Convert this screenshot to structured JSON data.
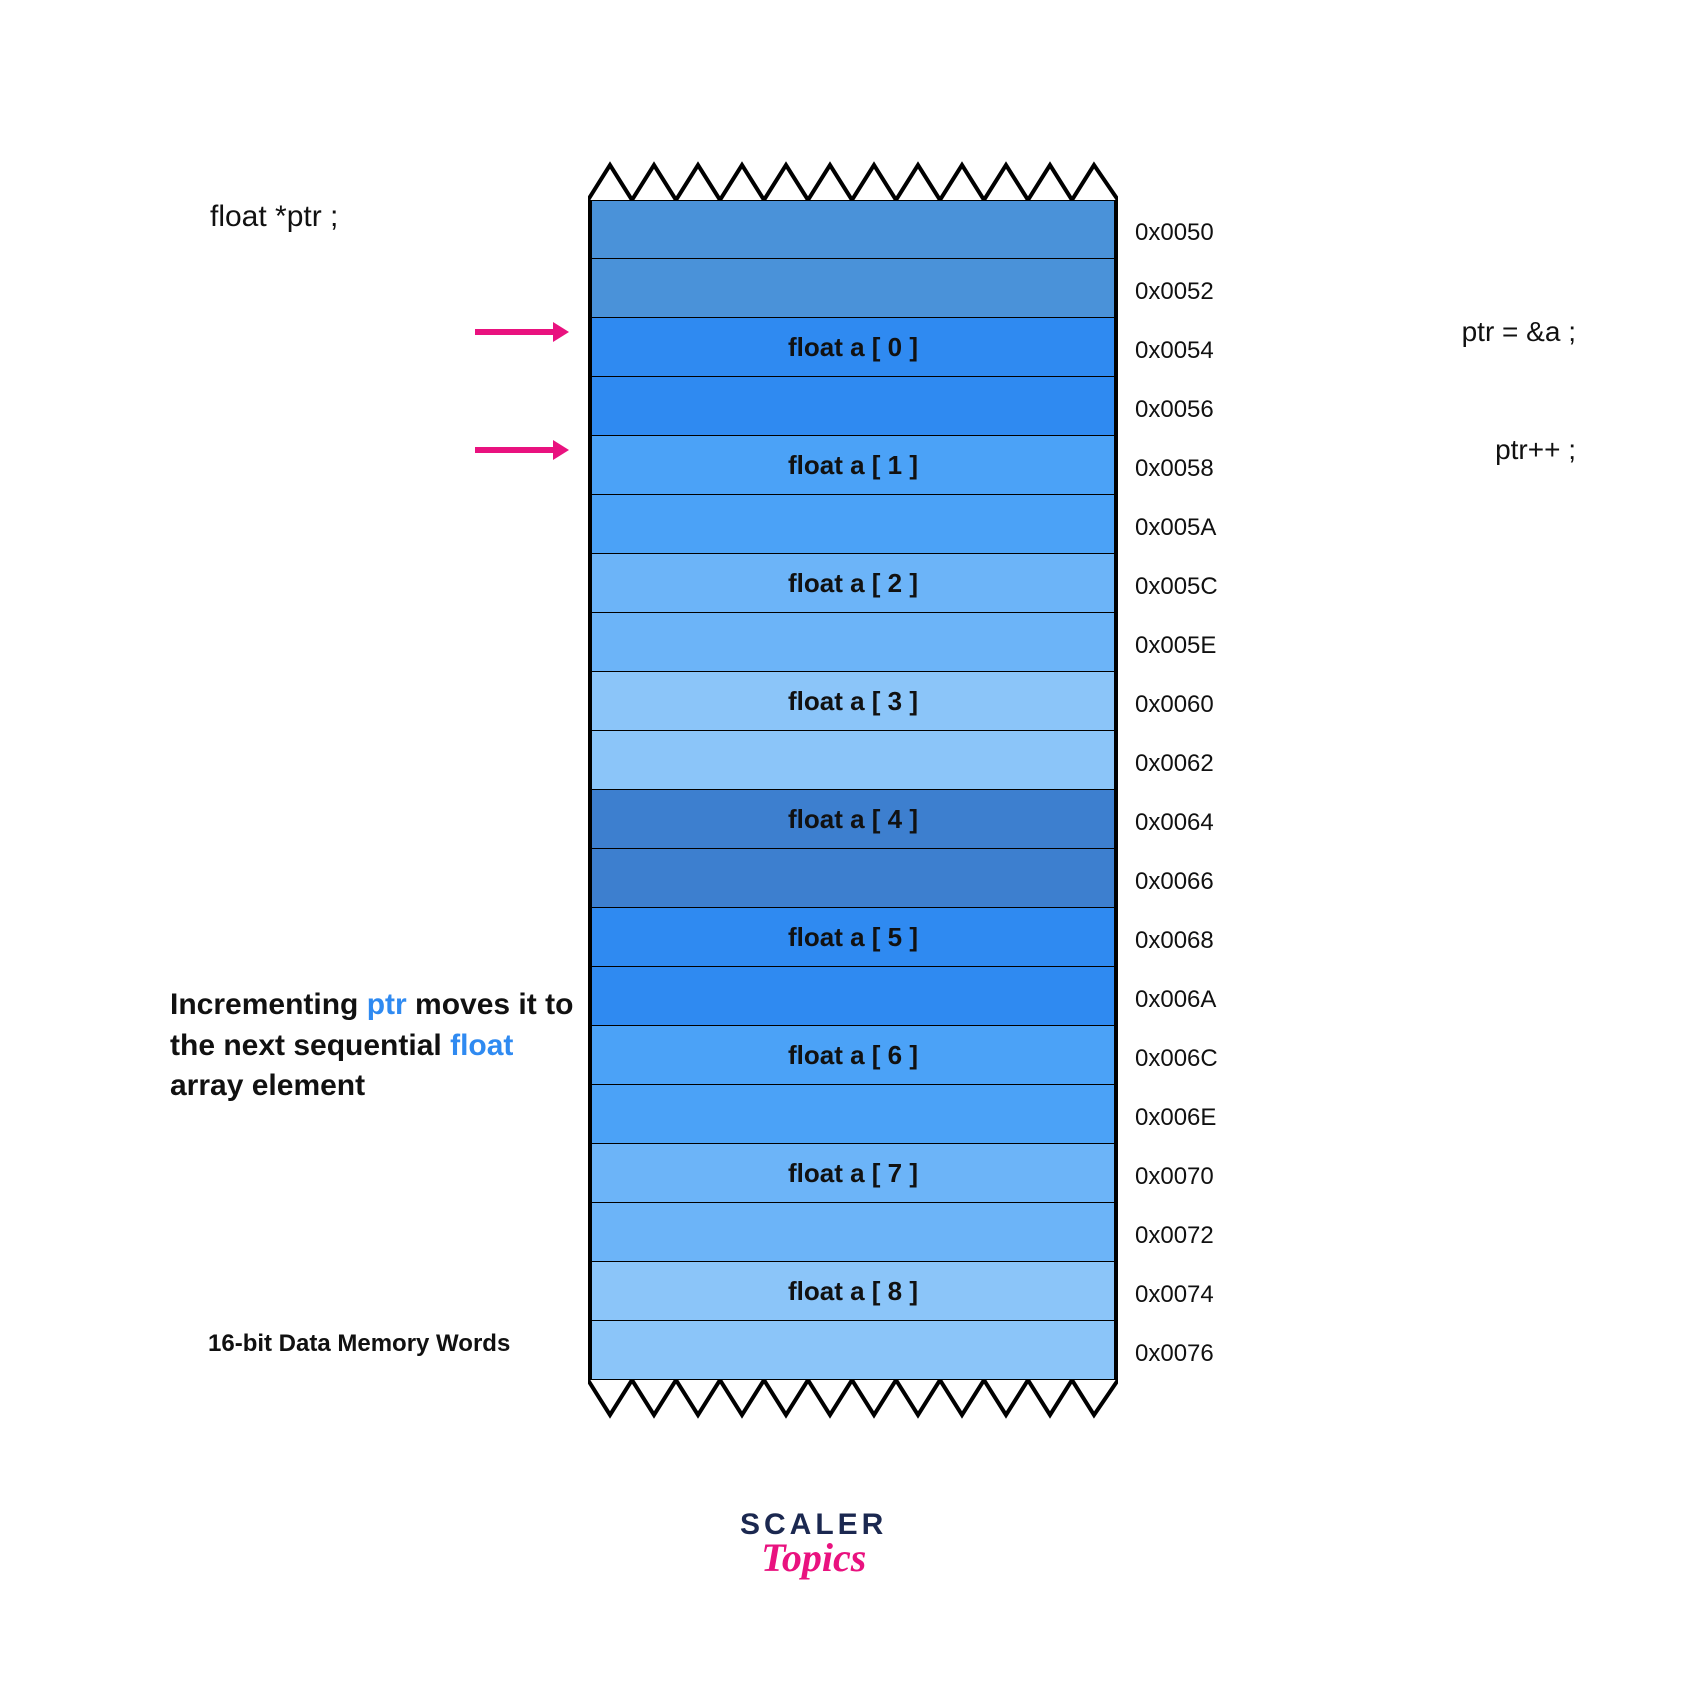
{
  "declaration": "float *ptr ;",
  "annot1": "ptr = &a ;",
  "annot2": "ptr++ ;",
  "explanation": {
    "p1": "Incrementing ",
    "hl1": "ptr",
    "p2": " moves it to the next sequential ",
    "hl2": "float",
    "p3": " array element"
  },
  "caption": "16-bit Data Memory Words",
  "memory_rows": [
    {
      "label": "",
      "addr": "0x0050",
      "color": "#4a92d9"
    },
    {
      "label": "",
      "addr": "0x0052",
      "color": "#4a92d9"
    },
    {
      "label": "float a [ 0 ]",
      "addr": "0x0054",
      "color": "#2f8af1"
    },
    {
      "label": "",
      "addr": "0x0056",
      "color": "#2f8af1"
    },
    {
      "label": "float a [ 1 ]",
      "addr": "0x0058",
      "color": "#4ba2f7"
    },
    {
      "label": "",
      "addr": "0x005A",
      "color": "#4ba2f7"
    },
    {
      "label": "float a [ 2 ]",
      "addr": "0x005C",
      "color": "#6cb4f8"
    },
    {
      "label": "",
      "addr": "0x005E",
      "color": "#6cb4f8"
    },
    {
      "label": "float a [ 3 ]",
      "addr": "0x0060",
      "color": "#8bc5f9"
    },
    {
      "label": "",
      "addr": "0x0062",
      "color": "#8bc5f9"
    },
    {
      "label": "float a [ 4 ]",
      "addr": "0x0064",
      "color": "#3d7fcf"
    },
    {
      "label": "",
      "addr": "0x0066",
      "color": "#3d7fcf"
    },
    {
      "label": "float a [ 5 ]",
      "addr": "0x0068",
      "color": "#2f8af1"
    },
    {
      "label": "",
      "addr": "0x006A",
      "color": "#2f8af1"
    },
    {
      "label": "float a [ 6 ]",
      "addr": "0x006C",
      "color": "#4ba2f7"
    },
    {
      "label": "",
      "addr": "0x006E",
      "color": "#4ba2f7"
    },
    {
      "label": "float a [ 7 ]",
      "addr": "0x0070",
      "color": "#6cb4f8"
    },
    {
      "label": "",
      "addr": "0x0072",
      "color": "#6cb4f8"
    },
    {
      "label": "float a [ 8 ]",
      "addr": "0x0074",
      "color": "#8bc5f9"
    },
    {
      "label": "",
      "addr": "0x0076",
      "color": "#8bc5f9"
    }
  ],
  "logo": {
    "line1": "SCALER",
    "line2": "Topics"
  }
}
